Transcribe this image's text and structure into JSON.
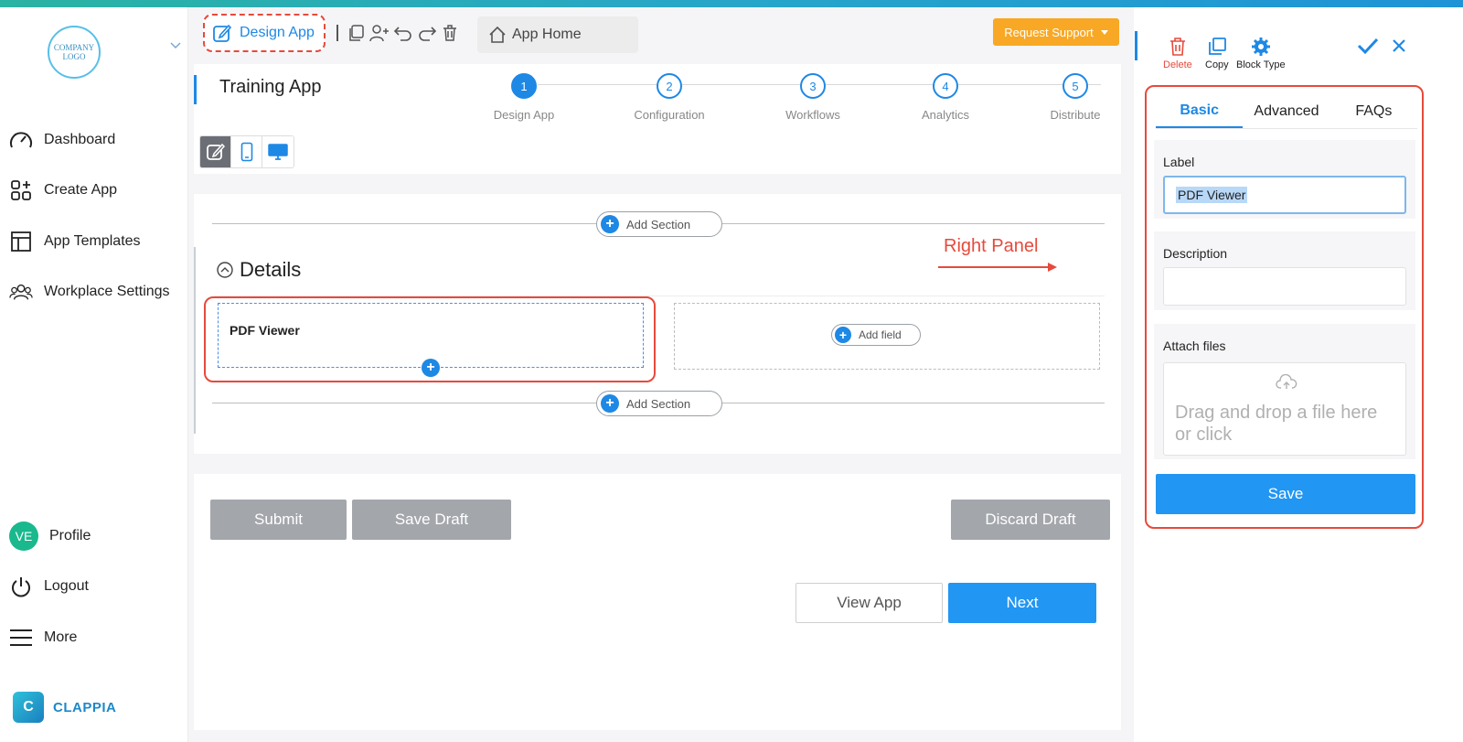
{
  "brand_colors": {
    "accent": "#1e88e5",
    "highlight": "#e64a3c",
    "warning": "#f8a824",
    "neutral_button": "#a3a6ab"
  },
  "sidebar": {
    "logo_text": "COMPANY LOGO",
    "items": [
      {
        "label": "Dashboard",
        "icon": "speedometer-icon"
      },
      {
        "label": "Create App",
        "icon": "grid-plus-icon"
      },
      {
        "label": "App Templates",
        "icon": "layout-icon"
      },
      {
        "label": "Workplace Settings",
        "icon": "users-icon"
      }
    ],
    "bottom": {
      "profile": {
        "avatar": "VE",
        "label": "Profile"
      },
      "logout": "Logout",
      "more": "More"
    },
    "brand": {
      "mark": "C",
      "name": "CLAPPIA"
    }
  },
  "header": {
    "design_tab": "Design App",
    "app_home": "App Home",
    "request_support": "Request Support"
  },
  "app": {
    "title": "Training App",
    "steps": [
      {
        "num": "1",
        "label": "Design App",
        "active": true
      },
      {
        "num": "2",
        "label": "Configuration",
        "active": false
      },
      {
        "num": "3",
        "label": "Workflows",
        "active": false
      },
      {
        "num": "4",
        "label": "Analytics",
        "active": false
      },
      {
        "num": "5",
        "label": "Distribute",
        "active": false
      }
    ]
  },
  "canvas": {
    "add_section": "Add Section",
    "annotation": "Right Panel",
    "section_title": "Details",
    "field_label": "PDF Viewer",
    "add_field": "Add field"
  },
  "form_actions": {
    "submit": "Submit",
    "save_draft": "Save Draft",
    "discard_draft": "Discard Draft",
    "view_app": "View App",
    "next": "Next"
  },
  "right_panel": {
    "actions": {
      "delete": "Delete",
      "copy": "Copy",
      "block_type": "Block Type"
    },
    "tabs": [
      {
        "label": "Basic",
        "active": true
      },
      {
        "label": "Advanced",
        "active": false
      },
      {
        "label": "FAQs",
        "active": false
      }
    ],
    "label_field": {
      "label": "Label",
      "value": "PDF Viewer"
    },
    "description_field": {
      "label": "Description",
      "value": ""
    },
    "attach_field": {
      "label": "Attach files",
      "placeholder": "Drag and drop a file here or click"
    },
    "save": "Save"
  }
}
